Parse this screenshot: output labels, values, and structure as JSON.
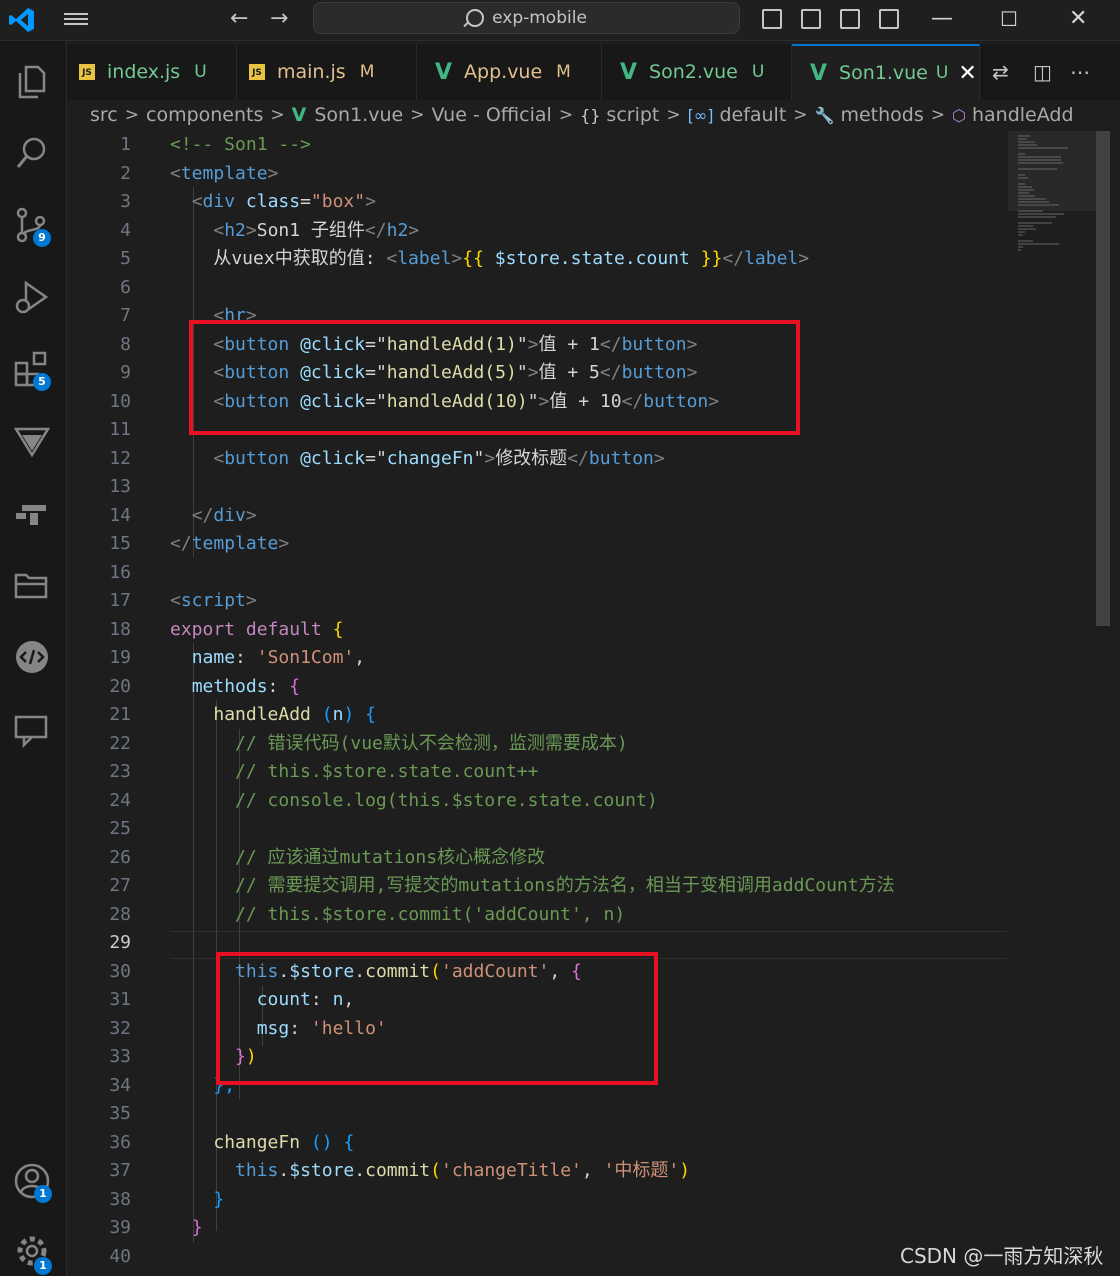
{
  "window": {
    "search_text": "exp-mobile"
  },
  "tabs": [
    {
      "icon": "JS",
      "label": "index.js",
      "status": "U",
      "status_color": "#73c991",
      "label_color": "#73c991"
    },
    {
      "icon": "JS",
      "label": "main.js",
      "status": "M",
      "status_color": "#e2c08d",
      "label_color": "#e2c08d"
    },
    {
      "icon": "V",
      "label": "App.vue",
      "status": "M",
      "status_color": "#e2c08d",
      "label_color": "#e2c08d"
    },
    {
      "icon": "V",
      "label": "Son2.vue",
      "status": "U",
      "status_color": "#73c991",
      "label_color": "#73c991"
    },
    {
      "icon": "V",
      "label": "Son1.vue",
      "status": "U",
      "status_color": "#73c991",
      "label_color": "#73c991",
      "active": true
    }
  ],
  "breadcrumb": [
    "src",
    "components",
    "Son1.vue",
    "Vue - Official",
    "script",
    "default",
    "methods",
    "handleAdd"
  ],
  "activity_badges": {
    "source_control": "9",
    "extensions": "5",
    "accounts": "1",
    "settings": "1"
  },
  "editor": {
    "current_line": 29,
    "lines": [
      {
        "n": "1",
        "t": [
          [
            "<!-- Son1 -->",
            "com"
          ]
        ]
      },
      {
        "n": "2",
        "t": [
          [
            "<",
            "br"
          ],
          [
            "template",
            "tag"
          ],
          [
            ">",
            "br"
          ]
        ]
      },
      {
        "n": "3",
        "t": [
          [
            "  ",
            "txt"
          ],
          [
            "<",
            "br"
          ],
          [
            "div",
            "tag"
          ],
          [
            " ",
            "txt"
          ],
          [
            "class",
            "attr"
          ],
          [
            "=",
            "txt"
          ],
          [
            "\"box\"",
            "str"
          ],
          [
            ">",
            "br"
          ]
        ]
      },
      {
        "n": "4",
        "t": [
          [
            "    ",
            "txt"
          ],
          [
            "<",
            "br"
          ],
          [
            "h2",
            "tag"
          ],
          [
            ">",
            "br"
          ],
          [
            "Son1 子组件",
            "txt"
          ],
          [
            "</",
            "br"
          ],
          [
            "h2",
            "tag"
          ],
          [
            ">",
            "br"
          ]
        ]
      },
      {
        "n": "5",
        "t": [
          [
            "    从vuex中获取的值: ",
            "txt"
          ],
          [
            "<",
            "br"
          ],
          [
            "label",
            "tag"
          ],
          [
            ">",
            "br"
          ],
          [
            "{{",
            "y"
          ],
          [
            " $store.state.count ",
            "attr"
          ],
          [
            "}}",
            "y"
          ],
          [
            "</",
            "br"
          ],
          [
            "label",
            "tag"
          ],
          [
            ">",
            "br"
          ]
        ]
      },
      {
        "n": "6",
        "t": []
      },
      {
        "n": "7",
        "t": [
          [
            "    ",
            "txt"
          ],
          [
            "<",
            "br"
          ],
          [
            "hr",
            "tag"
          ],
          [
            ">",
            "br"
          ]
        ]
      },
      {
        "n": "8",
        "t": [
          [
            "    ",
            "txt"
          ],
          [
            "<",
            "br"
          ],
          [
            "button",
            "tag"
          ],
          [
            " ",
            "txt"
          ],
          [
            "@click",
            "attr"
          ],
          [
            "=\"",
            "txt"
          ],
          [
            "handleAdd(1)",
            "fn"
          ],
          [
            "\"",
            "txt"
          ],
          [
            ">",
            "br"
          ],
          [
            "值 + 1",
            "txt"
          ],
          [
            "</",
            "br"
          ],
          [
            "button",
            "tag"
          ],
          [
            ">",
            "br"
          ]
        ]
      },
      {
        "n": "9",
        "t": [
          [
            "    ",
            "txt"
          ],
          [
            "<",
            "br"
          ],
          [
            "button",
            "tag"
          ],
          [
            " ",
            "txt"
          ],
          [
            "@click",
            "attr"
          ],
          [
            "=\"",
            "txt"
          ],
          [
            "handleAdd(5)",
            "fn"
          ],
          [
            "\"",
            "txt"
          ],
          [
            ">",
            "br"
          ],
          [
            "值 + 5",
            "txt"
          ],
          [
            "</",
            "br"
          ],
          [
            "button",
            "tag"
          ],
          [
            ">",
            "br"
          ]
        ]
      },
      {
        "n": "10",
        "t": [
          [
            "    ",
            "txt"
          ],
          [
            "<",
            "br"
          ],
          [
            "button",
            "tag"
          ],
          [
            " ",
            "txt"
          ],
          [
            "@click",
            "attr"
          ],
          [
            "=\"",
            "txt"
          ],
          [
            "handleAdd(10)",
            "fn"
          ],
          [
            "\"",
            "txt"
          ],
          [
            ">",
            "br"
          ],
          [
            "值 + 10",
            "txt"
          ],
          [
            "</",
            "br"
          ],
          [
            "button",
            "tag"
          ],
          [
            ">",
            "br"
          ]
        ]
      },
      {
        "n": "11",
        "t": []
      },
      {
        "n": "12",
        "t": [
          [
            "    ",
            "txt"
          ],
          [
            "<",
            "br"
          ],
          [
            "button",
            "tag"
          ],
          [
            " ",
            "txt"
          ],
          [
            "@click",
            "attr"
          ],
          [
            "=\"",
            "txt"
          ],
          [
            "changeFn",
            "attr"
          ],
          [
            "\"",
            "txt"
          ],
          [
            ">",
            "br"
          ],
          [
            "修改标题",
            "txt"
          ],
          [
            "</",
            "br"
          ],
          [
            "button",
            "tag"
          ],
          [
            ">",
            "br"
          ]
        ]
      },
      {
        "n": "13",
        "t": []
      },
      {
        "n": "14",
        "t": [
          [
            "  ",
            "txt"
          ],
          [
            "</",
            "br"
          ],
          [
            "div",
            "tag"
          ],
          [
            ">",
            "br"
          ]
        ]
      },
      {
        "n": "15",
        "t": [
          [
            "</",
            "br"
          ],
          [
            "template",
            "tag"
          ],
          [
            ">",
            "br"
          ]
        ]
      },
      {
        "n": "16",
        "t": []
      },
      {
        "n": "17",
        "t": [
          [
            "<",
            "br"
          ],
          [
            "script",
            "tag"
          ],
          [
            ">",
            "br"
          ]
        ]
      },
      {
        "n": "18",
        "t": [
          [
            "export default ",
            "kw"
          ],
          [
            "{",
            "y"
          ]
        ]
      },
      {
        "n": "19",
        "t": [
          [
            "  ",
            "txt"
          ],
          [
            "name",
            "attr"
          ],
          [
            ": ",
            "txt"
          ],
          [
            "'Son1Com'",
            "str"
          ],
          [
            ",",
            "txt"
          ]
        ]
      },
      {
        "n": "20",
        "t": [
          [
            "  ",
            "txt"
          ],
          [
            "methods",
            "attr"
          ],
          [
            ": ",
            "txt"
          ],
          [
            "{",
            "p"
          ]
        ]
      },
      {
        "n": "21",
        "t": [
          [
            "    ",
            "txt"
          ],
          [
            "handleAdd",
            "fn"
          ],
          [
            " ",
            "txt"
          ],
          [
            "(",
            "b"
          ],
          [
            "n",
            "attr"
          ],
          [
            ")",
            "b"
          ],
          [
            " ",
            "txt"
          ],
          [
            "{",
            "b"
          ]
        ]
      },
      {
        "n": "22",
        "t": [
          [
            "      // 错误代码(vue默认不会检测，监测需要成本)",
            "com"
          ]
        ]
      },
      {
        "n": "23",
        "t": [
          [
            "      // this.$store.state.count++",
            "com"
          ]
        ]
      },
      {
        "n": "24",
        "t": [
          [
            "      // console.log(this.$store.state.count)",
            "com"
          ]
        ]
      },
      {
        "n": "25",
        "t": []
      },
      {
        "n": "26",
        "t": [
          [
            "      // 应该通过mutations核心概念修改",
            "com"
          ]
        ]
      },
      {
        "n": "27",
        "t": [
          [
            "      // 需要提交调用,写提交的mutations的方法名，相当于变相调用addCount方法",
            "com"
          ]
        ]
      },
      {
        "n": "28",
        "t": [
          [
            "      // this.$store.commit('addCount', n)",
            "com"
          ]
        ]
      },
      {
        "n": "29",
        "t": []
      },
      {
        "n": "30",
        "t": [
          [
            "      ",
            "txt"
          ],
          [
            "this",
            "this"
          ],
          [
            ".",
            "txt"
          ],
          [
            "$store",
            "attr"
          ],
          [
            ".",
            "txt"
          ],
          [
            "commit",
            "fn"
          ],
          [
            "(",
            "y"
          ],
          [
            "'addCount'",
            "str"
          ],
          [
            ", ",
            "txt"
          ],
          [
            "{",
            "p"
          ]
        ]
      },
      {
        "n": "31",
        "t": [
          [
            "        ",
            "txt"
          ],
          [
            "count",
            "attr"
          ],
          [
            ": ",
            "txt"
          ],
          [
            "n",
            "attr"
          ],
          [
            ",",
            "txt"
          ]
        ]
      },
      {
        "n": "32",
        "t": [
          [
            "        ",
            "txt"
          ],
          [
            "msg",
            "attr"
          ],
          [
            ": ",
            "txt"
          ],
          [
            "'hello'",
            "str"
          ]
        ]
      },
      {
        "n": "33",
        "t": [
          [
            "      ",
            "txt"
          ],
          [
            "}",
            "p"
          ],
          [
            ")",
            "y"
          ]
        ]
      },
      {
        "n": "34",
        "t": [
          [
            "    ",
            "txt"
          ],
          [
            "},",
            "b"
          ]
        ]
      },
      {
        "n": "35",
        "t": []
      },
      {
        "n": "36",
        "t": [
          [
            "    ",
            "txt"
          ],
          [
            "changeFn",
            "fn"
          ],
          [
            " ",
            "txt"
          ],
          [
            "()",
            "b"
          ],
          [
            " ",
            "txt"
          ],
          [
            "{",
            "b"
          ]
        ]
      },
      {
        "n": "37",
        "t": [
          [
            "      ",
            "txt"
          ],
          [
            "this",
            "this"
          ],
          [
            ".",
            "txt"
          ],
          [
            "$store",
            "attr"
          ],
          [
            ".",
            "txt"
          ],
          [
            "commit",
            "fn"
          ],
          [
            "(",
            "y"
          ],
          [
            "'changeTitle'",
            "str"
          ],
          [
            ", ",
            "txt"
          ],
          [
            "'中标题'",
            "str"
          ],
          [
            ")",
            "y"
          ]
        ]
      },
      {
        "n": "38",
        "t": [
          [
            "    ",
            "txt"
          ],
          [
            "}",
            "b"
          ]
        ]
      },
      {
        "n": "39",
        "t": [
          [
            "  ",
            "txt"
          ],
          [
            "}",
            "p"
          ]
        ]
      },
      {
        "n": "40",
        "t": []
      }
    ]
  },
  "watermark": "CSDN @一雨方知深秋",
  "colors": {
    "accent": "#0078d4",
    "highlight": "#e81123",
    "vue": "#41b883"
  }
}
